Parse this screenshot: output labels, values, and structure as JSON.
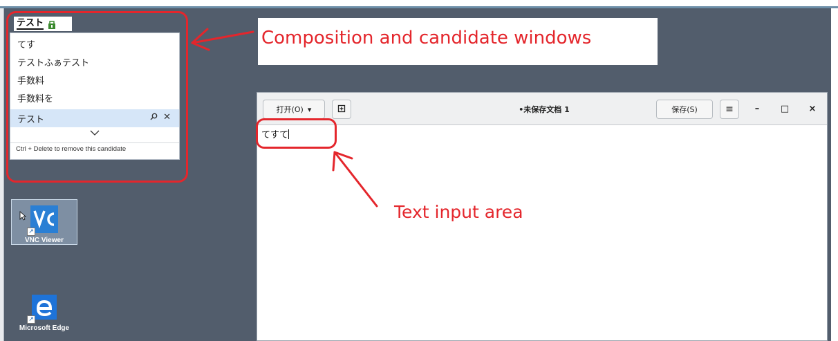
{
  "ime": {
    "composition_text": "テスト",
    "mode_icon": "ime-mode-icon",
    "candidates": [
      {
        "label": "てす"
      },
      {
        "label": "テストふぁテスト"
      },
      {
        "label": "手数料"
      },
      {
        "label": "手数料を"
      },
      {
        "label": "テスト",
        "selected": true
      }
    ],
    "candidate_actions": {
      "search_icon": "search-icon",
      "remove_icon": "close-icon",
      "remove_glyph": "✕"
    },
    "more_icon": "chevron-down-icon",
    "hint": "Ctrl + Delete to remove this candidate"
  },
  "annotations": {
    "composition_label": "Composition and candidate windows",
    "text_area_label": "Text input area",
    "color": "#e4262c"
  },
  "desktop": {
    "background": "#525d6c",
    "icons": [
      {
        "name": "vnc-viewer-icon",
        "label": "VNC Viewer",
        "selected": true
      },
      {
        "name": "microsoft-edge-icon",
        "label": "Microsoft Edge",
        "selected": false
      }
    ]
  },
  "gedit": {
    "open_label": "打开(O)",
    "open_chevron": "▾",
    "new_tab_icon": "new-document-icon",
    "title": "•未保存文档 1",
    "save_label": "保存(S)",
    "menu_icon": "hamburger-menu-icon",
    "menu_glyph": "≡",
    "minimize_glyph": "–",
    "maximize_glyph": "□",
    "close_glyph": "×",
    "content": "てすて"
  }
}
